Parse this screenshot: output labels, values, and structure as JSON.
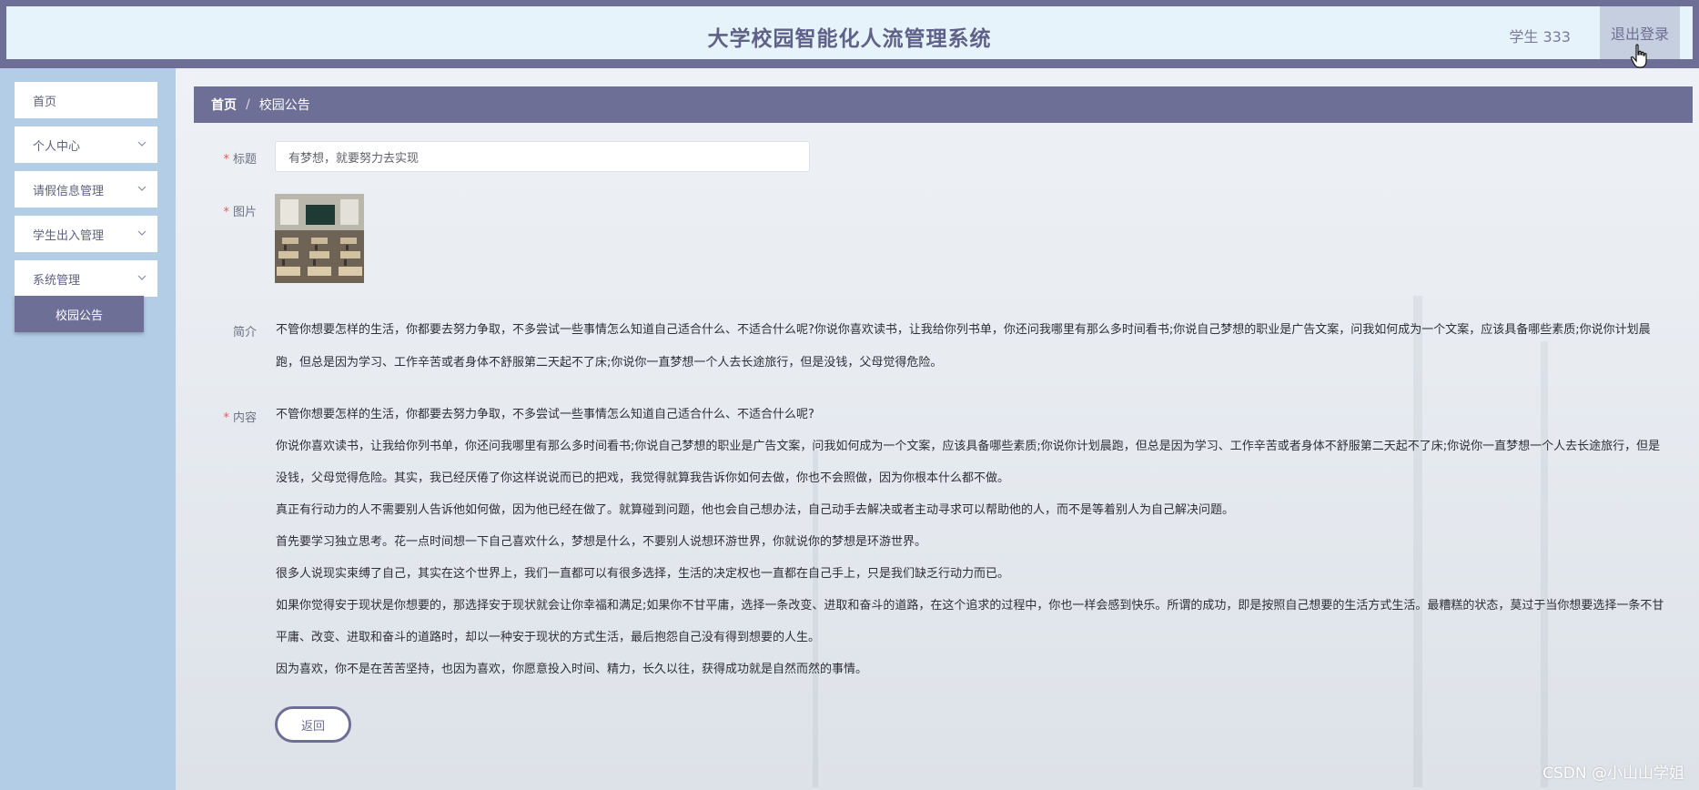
{
  "header": {
    "title": "大学校园智能化人流管理系统",
    "user": "学生 333",
    "logout": "退出登录"
  },
  "sidebar": {
    "items": [
      {
        "label": "首页",
        "has_arrow": false
      },
      {
        "label": "个人中心",
        "has_arrow": true
      },
      {
        "label": "请假信息管理",
        "has_arrow": true
      },
      {
        "label": "学生出入管理",
        "has_arrow": true
      },
      {
        "label": "系统管理",
        "has_arrow": true
      }
    ],
    "active_subitem": "校园公告"
  },
  "breadcrumb": {
    "home": "首页",
    "separator": "/",
    "current": "校园公告"
  },
  "form": {
    "title_label": "标题",
    "title_value": "有梦想，就要努力去实现",
    "image_label": "图片",
    "intro_label": "简介",
    "intro_text": "不管你想要怎样的生活，你都要去努力争取，不多尝试一些事情怎么知道自己适合什么、不适合什么呢?你说你喜欢读书，让我给你列书单，你还问我哪里有那么多时间看书;你说自己梦想的职业是广告文案，问我如何成为一个文案，应该具备哪些素质;你说你计划晨跑，但总是因为学习、工作辛苦或者身体不舒服第二天起不了床;你说你一直梦想一个人去长途旅行，但是没钱，父母觉得危险。",
    "content_label": "内容",
    "content_paragraphs": [
      "不管你想要怎样的生活，你都要去努力争取，不多尝试一些事情怎么知道自己适合什么、不适合什么呢?",
      "你说你喜欢读书，让我给你列书单，你还问我哪里有那么多时间看书;你说自己梦想的职业是广告文案，问我如何成为一个文案，应该具备哪些素质;你说你计划晨跑，但总是因为学习、工作辛苦或者身体不舒服第二天起不了床;你说你一直梦想一个人去长途旅行，但是没钱，父母觉得危险。其实，我已经厌倦了你这样说说而已的把戏，我觉得就算我告诉你如何去做，你也不会照做，因为你根本什么都不做。",
      "真正有行动力的人不需要别人告诉他如何做，因为他已经在做了。就算碰到问题，他也会自己想办法，自己动手去解决或者主动寻求可以帮助他的人，而不是等着别人为自己解决问题。",
      "首先要学习独立思考。花一点时间想一下自己喜欢什么，梦想是什么，不要别人说想环游世界，你就说你的梦想是环游世界。",
      "很多人说现实束缚了自己，其实在这个世界上，我们一直都可以有很多选择，生活的决定权也一直都在自己手上，只是我们缺乏行动力而已。",
      "如果你觉得安于现状是你想要的，那选择安于现状就会让你幸福和满足;如果你不甘平庸，选择一条改变、进取和奋斗的道路，在这个追求的过程中，你也一样会感到快乐。所谓的成功，即是按照自己想要的生活方式生活。最糟糕的状态，莫过于当你想要选择一条不甘平庸、改变、进取和奋斗的道路时，却以一种安于现状的方式生活，最后抱怨自己没有得到想要的人生。",
      "因为喜欢，你不是在苦苦坚持，也因为喜欢，你愿意投入时间、精力，长久以往，获得成功就是自然而然的事情。"
    ],
    "back_button": "返回"
  },
  "watermark": "CSDN @小山山学姐",
  "colors": {
    "primary": "#6e6f96",
    "sidebar_bg": "#b4cde6",
    "header_bg": "#e6f3fb",
    "required": "#e35b5b"
  }
}
